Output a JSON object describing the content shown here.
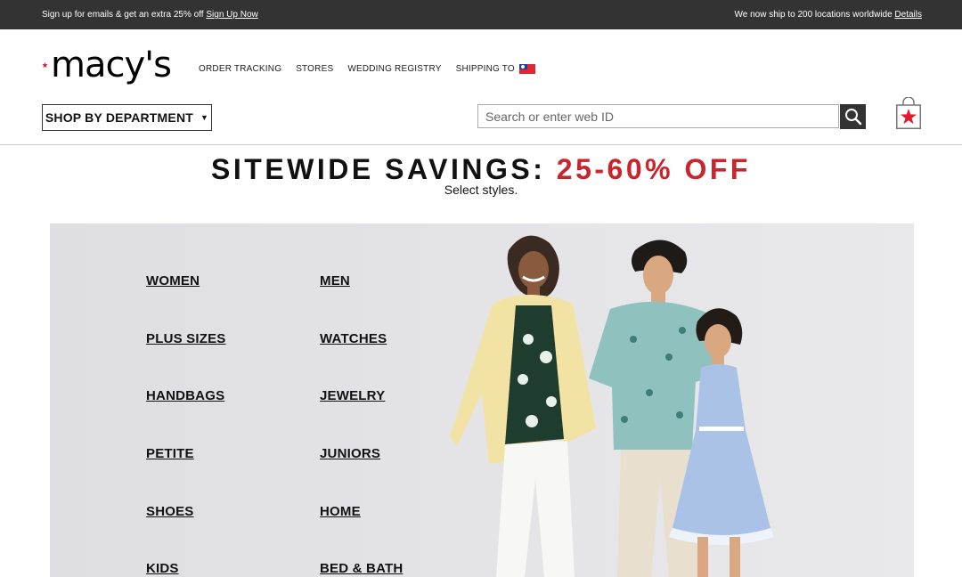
{
  "topbar": {
    "promo_text": "Sign up for emails & get an extra 25% off",
    "promo_link": "Sign Up Now",
    "ship_text": "We now ship to 200 locations worldwide",
    "ship_link": "Details"
  },
  "logo": {
    "wordmark": "macy's",
    "star_color": "#e21a2c"
  },
  "util_nav": {
    "order_tracking": "ORDER TRACKING",
    "stores": "STORES",
    "wedding_registry": "WEDDING REGISTRY",
    "shipping_to": "SHIPPING TO",
    "flag_icon": "taiwan-flag-icon"
  },
  "shop_by_department": {
    "label": "SHOP BY DEPARTMENT",
    "caret": "▼"
  },
  "search": {
    "placeholder": "Search or enter web ID",
    "value": "",
    "icon": "search-icon"
  },
  "bag": {
    "icon": "shopping-bag-icon"
  },
  "promo": {
    "headline": "SITEWIDE SAVINGS:",
    "offer": "25-60% OFF",
    "subtext": "Select styles.",
    "accent_color": "#c9252c"
  },
  "categories": [
    "WOMEN",
    "MEN",
    "PLUS SIZES",
    "WATCHES",
    "HANDBAGS",
    "JEWELRY",
    "PETITE",
    "JUNIORS",
    "SHOES",
    "HOME",
    "KIDS",
    "BED & BATH"
  ]
}
